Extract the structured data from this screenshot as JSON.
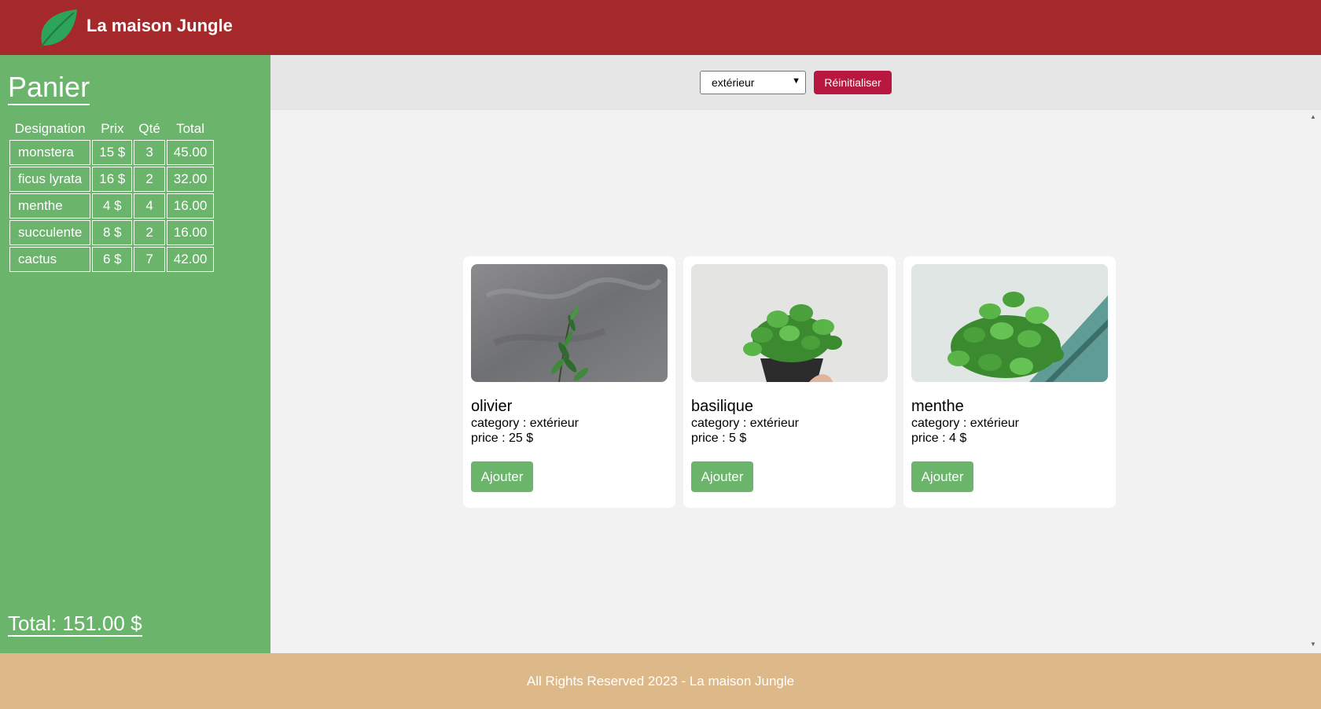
{
  "header": {
    "brand": "La maison Jungle",
    "logo_icon": "leaf-icon",
    "background": "#a5292b"
  },
  "cart": {
    "title": "Panier",
    "columns": [
      "Designation",
      "Prix",
      "Qté",
      "Total"
    ],
    "rows": [
      {
        "name": "monstera",
        "price": "15 $",
        "qty": "3",
        "total": "45.00"
      },
      {
        "name": "ficus lyrata",
        "price": "16 $",
        "qty": "2",
        "total": "32.00"
      },
      {
        "name": "menthe",
        "price": "4 $",
        "qty": "4",
        "total": "16.00"
      },
      {
        "name": "succulente",
        "price": "8 $",
        "qty": "2",
        "total": "16.00"
      },
      {
        "name": "cactus",
        "price": "6 $",
        "qty": "7",
        "total": "42.00"
      }
    ],
    "total": "Total: 151.00 $",
    "background": "#6ab46b"
  },
  "filter": {
    "selected": "extérieur",
    "reset_label": "Réinitialiser",
    "reset_color": "#b8173f"
  },
  "products": [
    {
      "name": "olivier",
      "category": "category : extérieur",
      "price": "price : 25 $",
      "button": "Ajouter",
      "image": "olive-tree-photo"
    },
    {
      "name": "basilique",
      "category": "category : extérieur",
      "price": "price : 5 $",
      "button": "Ajouter",
      "image": "basil-photo"
    },
    {
      "name": "menthe",
      "category": "category : extérieur",
      "price": "price : 4 $",
      "button": "Ajouter",
      "image": "mint-photo"
    }
  ],
  "footer": {
    "text": "All Rights Reserved 2023 - La maison Jungle",
    "background": "#ddb888"
  }
}
